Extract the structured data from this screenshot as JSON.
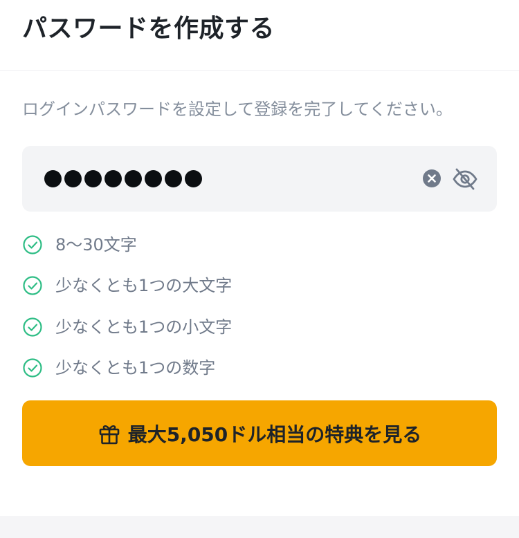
{
  "header": {
    "title": "パスワードを作成する"
  },
  "description": "ログインパスワードを設定して登録を完了してください。",
  "password": {
    "masked_length": 8
  },
  "rules": [
    {
      "label": "8〜30文字",
      "met": true
    },
    {
      "label": "少なくとも1つの大文字",
      "met": true
    },
    {
      "label": "少なくとも1つの小文字",
      "met": true
    },
    {
      "label": "少なくとも1つの数字",
      "met": true
    }
  ],
  "cta": {
    "label": "最大5,050ドル相当の特典を見る",
    "icon": "gift-icon"
  },
  "colors": {
    "accent": "#f6a600",
    "success": "#2ebd85",
    "title": "#1e2329",
    "muted": "#848e9c"
  }
}
